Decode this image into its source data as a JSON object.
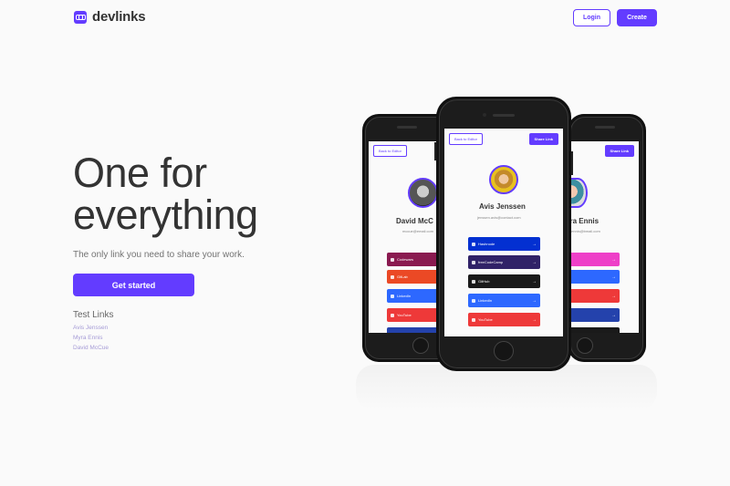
{
  "header": {
    "logo_text": "devlinks",
    "login_label": "Login",
    "create_label": "Create"
  },
  "hero": {
    "title_line1": "One for",
    "title_line2": "everything",
    "subtitle": "The only link you need to share your work.",
    "cta_label": "Get started"
  },
  "test_links": {
    "title": "Test Links",
    "items": [
      "Avis Jenssen",
      "Myra Ennis",
      "David McCue"
    ]
  },
  "phones": {
    "left": {
      "back_label": "Back to Editor",
      "name": "David McC",
      "email": "mccue@email.com",
      "links": [
        {
          "label": "Codewars",
          "color": "#8a1a50"
        },
        {
          "label": "GitLab",
          "color": "#eb4925"
        },
        {
          "label": "LinkedIn",
          "color": "#2d68ff"
        },
        {
          "label": "YouTube",
          "color": "#ee3939"
        }
      ]
    },
    "center": {
      "back_label": "Back to Editor",
      "share_label": "Share Link",
      "name": "Avis Jenssen",
      "email": "jenssen.avis@contact.com",
      "links": [
        {
          "label": "Hashnode",
          "color": "#0330d1"
        },
        {
          "label": "freeCodeCamp",
          "color": "#302267"
        },
        {
          "label": "GitHub",
          "color": "#1a1a1a"
        },
        {
          "label": "LinkedIn",
          "color": "#2d68ff"
        },
        {
          "label": "YouTube",
          "color": "#ee3939"
        }
      ]
    },
    "right": {
      "share_label": "Share Link",
      "name": "yra Ennis",
      "email": "ennis@bmail.com",
      "links": [
        {
          "label": "",
          "color": "#ee3fc8"
        },
        {
          "label": "in",
          "color": "#2d68ff"
        },
        {
          "label": "be",
          "color": "#ee3939"
        },
        {
          "label": "ook",
          "color": "#2442ac"
        }
      ]
    }
  },
  "colors": {
    "accent": "#633cff",
    "text": "#333333",
    "muted": "#737373"
  }
}
